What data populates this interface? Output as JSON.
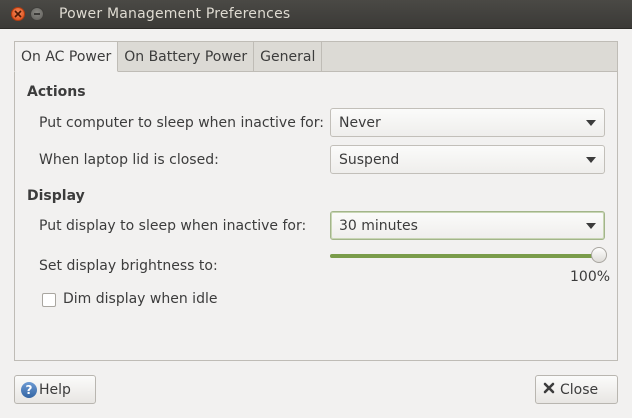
{
  "window": {
    "title": "Power Management Preferences"
  },
  "tabs": [
    "On AC Power",
    "On Battery Power",
    "General"
  ],
  "actions": {
    "heading": "Actions",
    "sleep_label": "Put computer to sleep when inactive for:",
    "sleep_value": "Never",
    "lid_label": "When laptop lid is closed:",
    "lid_value": "Suspend"
  },
  "display": {
    "heading": "Display",
    "display_sleep_label": "Put display to sleep when inactive for:",
    "display_sleep_value": "30 minutes",
    "brightness_label": "Set display brightness to:",
    "brightness_value_text": "100%",
    "brightness_fraction": 1.0,
    "dim_label": "Dim display when idle",
    "dim_checked": false
  },
  "buttons": {
    "help": "Help",
    "close": "Close"
  },
  "icons": {
    "window_close": "close-window-icon",
    "window_minimize": "minimize-window-icon",
    "help": "help-icon",
    "close": "close-icon",
    "dropdown": "chevron-down-icon"
  },
  "colors": {
    "accent": "#7a9c4a",
    "close_button": "#dd4814"
  }
}
